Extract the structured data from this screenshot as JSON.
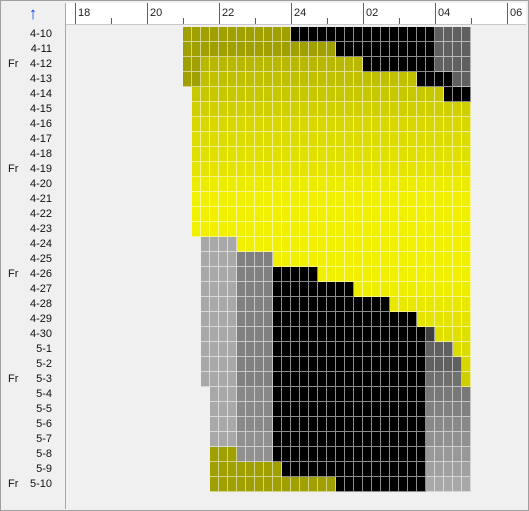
{
  "sort_button": {
    "icon": "up-arrow-icon",
    "glyph": "↑"
  },
  "time_ruler": {
    "labels": [
      "18",
      "20",
      "22",
      "24",
      "02",
      "04",
      "06"
    ]
  },
  "rows": [
    {
      "dow": "",
      "date": "4-10",
      "blocks": [
        [
          21.0,
          24.0,
          "#a0a000"
        ],
        [
          24.0,
          28.0,
          "#000000"
        ],
        [
          28.0,
          29.0,
          "#606060"
        ]
      ]
    },
    {
      "dow": "",
      "date": "4-11",
      "blocks": [
        [
          21.0,
          25.25,
          "#a0a000"
        ],
        [
          25.25,
          28.0,
          "#000000"
        ],
        [
          28.0,
          29.0,
          "#606060"
        ]
      ]
    },
    {
      "dow": "Fr",
      "date": "4-12",
      "blocks": [
        [
          21.0,
          21.5,
          "#a0a000"
        ],
        [
          21.5,
          26.0,
          "#b8b800"
        ],
        [
          26.0,
          28.0,
          "#000000"
        ],
        [
          28.0,
          29.0,
          "#606060"
        ]
      ]
    },
    {
      "dow": "",
      "date": "4-13",
      "blocks": [
        [
          21.0,
          21.5,
          "#a0a000"
        ],
        [
          21.5,
          27.5,
          "#c0c000"
        ],
        [
          27.5,
          28.5,
          "#000000"
        ],
        [
          28.5,
          29.0,
          "#606060"
        ]
      ]
    },
    {
      "dow": "",
      "date": "4-14",
      "blocks": [
        [
          21.25,
          28.25,
          "#c8c800"
        ],
        [
          28.25,
          29.0,
          "#000000"
        ],
        [
          29.0,
          29.0,
          "#606060"
        ]
      ]
    },
    {
      "dow": "",
      "date": "4-15",
      "blocks": [
        [
          21.25,
          29.0,
          "#d0d000"
        ],
        [
          29.0,
          29.0,
          "#505050"
        ]
      ]
    },
    {
      "dow": "",
      "date": "4-16",
      "blocks": [
        [
          21.25,
          29.0,
          "#d8d800"
        ],
        [
          29.0,
          29.0,
          "#505050"
        ]
      ]
    },
    {
      "dow": "",
      "date": "4-17",
      "blocks": [
        [
          21.25,
          29.0,
          "#dcdc00"
        ]
      ]
    },
    {
      "dow": "",
      "date": "4-18",
      "blocks": [
        [
          21.25,
          29.0,
          "#e0e000"
        ]
      ]
    },
    {
      "dow": "Fr",
      "date": "4-19",
      "blocks": [
        [
          21.25,
          29.0,
          "#e4e400"
        ]
      ]
    },
    {
      "dow": "",
      "date": "4-20",
      "blocks": [
        [
          21.25,
          29.0,
          "#ecec00"
        ]
      ]
    },
    {
      "dow": "",
      "date": "4-21",
      "blocks": [
        [
          21.25,
          29.0,
          "#f0f000"
        ]
      ]
    },
    {
      "dow": "",
      "date": "4-22",
      "blocks": [
        [
          21.25,
          29.0,
          "#f0f000"
        ]
      ]
    },
    {
      "dow": "",
      "date": "4-23",
      "blocks": [
        [
          21.25,
          29.0,
          "#f0f000"
        ]
      ]
    },
    {
      "dow": "",
      "date": "4-24",
      "blocks": [
        [
          21.5,
          22.5,
          "#a8a8a8"
        ],
        [
          22.5,
          29.0,
          "#f0f000"
        ]
      ]
    },
    {
      "dow": "",
      "date": "4-25",
      "blocks": [
        [
          21.5,
          22.5,
          "#a8a8a8"
        ],
        [
          22.5,
          23.5,
          "#808080"
        ],
        [
          23.5,
          29.0,
          "#f0f000"
        ]
      ]
    },
    {
      "dow": "Fr",
      "date": "4-26",
      "blocks": [
        [
          21.5,
          22.5,
          "#a8a8a8"
        ],
        [
          22.5,
          23.5,
          "#808080"
        ],
        [
          23.5,
          24.75,
          "#000000"
        ],
        [
          24.75,
          29.0,
          "#f0f000"
        ]
      ]
    },
    {
      "dow": "",
      "date": "4-27",
      "blocks": [
        [
          21.5,
          22.5,
          "#a8a8a8"
        ],
        [
          22.5,
          23.5,
          "#808080"
        ],
        [
          23.5,
          25.75,
          "#000000"
        ],
        [
          25.75,
          29.0,
          "#eded00"
        ]
      ]
    },
    {
      "dow": "",
      "date": "4-28",
      "blocks": [
        [
          21.5,
          22.5,
          "#a8a8a8"
        ],
        [
          22.5,
          23.5,
          "#808080"
        ],
        [
          23.5,
          26.75,
          "#000000"
        ],
        [
          26.75,
          29.0,
          "#e8e800"
        ]
      ]
    },
    {
      "dow": "",
      "date": "4-29",
      "blocks": [
        [
          21.5,
          22.5,
          "#a8a8a8"
        ],
        [
          22.5,
          23.5,
          "#808080"
        ],
        [
          23.5,
          27.5,
          "#000000"
        ],
        [
          27.5,
          29.0,
          "#e4e400"
        ]
      ]
    },
    {
      "dow": "",
      "date": "4-30",
      "blocks": [
        [
          21.5,
          22.5,
          "#a8a8a8"
        ],
        [
          22.5,
          23.5,
          "#808080"
        ],
        [
          23.5,
          27.75,
          "#000000"
        ],
        [
          27.75,
          28.0,
          "#404040"
        ],
        [
          28.0,
          29.0,
          "#e0e000"
        ]
      ]
    },
    {
      "dow": "",
      "date": "5-1",
      "blocks": [
        [
          21.5,
          22.5,
          "#a8a8a8"
        ],
        [
          22.5,
          23.5,
          "#808080"
        ],
        [
          23.5,
          27.75,
          "#000000"
        ],
        [
          27.75,
          28.5,
          "#606060"
        ],
        [
          28.5,
          29.0,
          "#dcdc00"
        ]
      ]
    },
    {
      "dow": "",
      "date": "5-2",
      "blocks": [
        [
          21.5,
          22.5,
          "#a8a8a8"
        ],
        [
          22.5,
          23.5,
          "#808080"
        ],
        [
          23.5,
          27.75,
          "#000000"
        ],
        [
          27.75,
          28.75,
          "#606060"
        ],
        [
          28.75,
          29.0,
          "#d8d800"
        ]
      ]
    },
    {
      "dow": "Fr",
      "date": "5-3",
      "blocks": [
        [
          21.5,
          22.5,
          "#a8a8a8"
        ],
        [
          22.5,
          23.5,
          "#808080"
        ],
        [
          23.5,
          27.75,
          "#000000"
        ],
        [
          27.75,
          28.75,
          "#707070"
        ],
        [
          28.75,
          29.0,
          "#d0d000"
        ]
      ]
    },
    {
      "dow": "",
      "date": "5-4",
      "blocks": [
        [
          21.75,
          22.5,
          "#a8a8a8"
        ],
        [
          22.5,
          23.5,
          "#888888"
        ],
        [
          23.5,
          27.75,
          "#000000"
        ],
        [
          27.75,
          29.0,
          "#787878"
        ],
        [
          29.0,
          29.0,
          "#c8c800"
        ]
      ]
    },
    {
      "dow": "",
      "date": "5-5",
      "blocks": [
        [
          21.75,
          22.5,
          "#a8a8a8"
        ],
        [
          22.5,
          23.5,
          "#888888"
        ],
        [
          23.5,
          27.75,
          "#000000"
        ],
        [
          27.75,
          29.0,
          "#808080"
        ]
      ]
    },
    {
      "dow": "",
      "date": "5-6",
      "blocks": [
        [
          21.75,
          22.5,
          "#a8a8a8"
        ],
        [
          22.5,
          23.5,
          "#888888"
        ],
        [
          23.5,
          27.75,
          "#000000"
        ],
        [
          27.75,
          29.0,
          "#888888"
        ]
      ]
    },
    {
      "dow": "",
      "date": "5-7",
      "blocks": [
        [
          21.75,
          22.5,
          "#a8a8a8"
        ],
        [
          22.5,
          23.5,
          "#909090"
        ],
        [
          23.5,
          27.75,
          "#000000"
        ],
        [
          27.75,
          29.0,
          "#909090"
        ]
      ]
    },
    {
      "dow": "",
      "date": "5-8",
      "blocks": [
        [
          21.75,
          22.5,
          "#a0a000"
        ],
        [
          22.5,
          23.5,
          "#909090"
        ],
        [
          23.5,
          27.75,
          "#000000"
        ],
        [
          27.75,
          29.0,
          "#989898"
        ]
      ]
    },
    {
      "dow": "",
      "date": "5-9",
      "blocks": [
        [
          21.75,
          23.75,
          "#a0a000"
        ],
        [
          23.75,
          27.75,
          "#000000"
        ],
        [
          27.75,
          29.0,
          "#a0a0a0"
        ]
      ]
    },
    {
      "dow": "Fr",
      "date": "5-10",
      "blocks": [
        [
          21.75,
          25.25,
          "#a0a000"
        ],
        [
          25.25,
          27.75,
          "#000000"
        ],
        [
          27.75,
          29.0,
          "#a8a8a8"
        ]
      ]
    }
  ]
}
